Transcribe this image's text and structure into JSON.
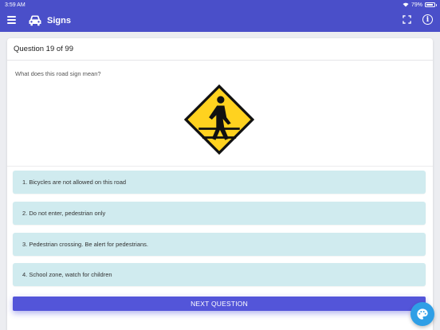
{
  "status_bar": {
    "time": "3:59 AM",
    "battery": "79%"
  },
  "app_bar": {
    "title": "Signs",
    "icons": [
      "menu-icon",
      "car-icon",
      "fullscreen-icon",
      "info-icon"
    ],
    "color": "#4a4fc9"
  },
  "quiz": {
    "header": "Question 19 of 99",
    "question": "What does this road sign mean?",
    "sign_icon": "pedestrian-crossing-sign",
    "options": [
      "1. Bicycles are not allowed on this road",
      "2. Do not enter, pedestrian only",
      "3. Pedestrian crossing. Be alert for pedestrians.",
      "4. School zone, watch for children"
    ],
    "next_label": "NEXT QUESTION"
  },
  "fab": {
    "icon": "palette-icon",
    "color": "#2f9fe6"
  },
  "colors": {
    "option_bg": "#d0ebef",
    "button": "#5355d9",
    "sign_yellow": "#ffd21f"
  }
}
